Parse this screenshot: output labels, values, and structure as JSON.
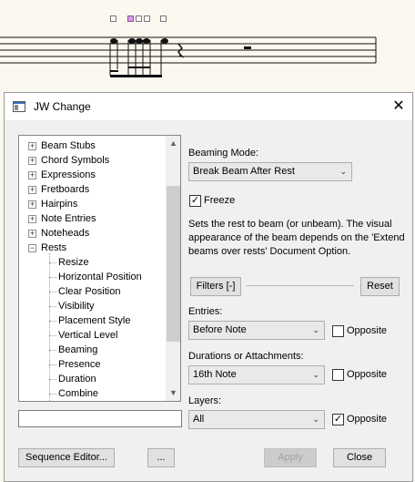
{
  "dialog": {
    "title": "JW Change",
    "close_glyph": "✕"
  },
  "tree": {
    "expand_glyph": "+",
    "collapse_glyph": "−",
    "items": [
      {
        "label": "Beam Stubs",
        "kind": "collapsed"
      },
      {
        "label": "Chord Symbols",
        "kind": "collapsed"
      },
      {
        "label": "Expressions",
        "kind": "collapsed"
      },
      {
        "label": "Fretboards",
        "kind": "collapsed"
      },
      {
        "label": "Hairpins",
        "kind": "collapsed"
      },
      {
        "label": "Note Entries",
        "kind": "collapsed"
      },
      {
        "label": "Noteheads",
        "kind": "collapsed"
      },
      {
        "label": "Rests",
        "kind": "expanded"
      },
      {
        "label": "Resize",
        "kind": "child"
      },
      {
        "label": "Horizontal Position",
        "kind": "child"
      },
      {
        "label": "Clear Position",
        "kind": "child"
      },
      {
        "label": "Visibility",
        "kind": "child"
      },
      {
        "label": "Placement Style",
        "kind": "child"
      },
      {
        "label": "Vertical Level",
        "kind": "child"
      },
      {
        "label": "Beaming",
        "kind": "child"
      },
      {
        "label": "Presence",
        "kind": "child"
      },
      {
        "label": "Duration",
        "kind": "child"
      },
      {
        "label": "Combine",
        "kind": "child"
      }
    ]
  },
  "filter_input": {
    "value": ""
  },
  "beaming": {
    "label": "Beaming Mode:",
    "value": "Break Beam After Rest",
    "freeze_label": "Freeze",
    "freeze_checked": true,
    "description": "Sets the rest to beam (or unbeam). The visual appearance of the beam depends on the 'Extend beams over rests' Document Option."
  },
  "filters": {
    "button": "Filters [-]",
    "reset": "Reset"
  },
  "entries": {
    "label": "Entries:",
    "value": "Before Note",
    "opposite_label": "Opposite",
    "opposite_checked": false
  },
  "durations": {
    "label": "Durations or Attachments:",
    "value": "16th Note",
    "opposite_label": "Opposite",
    "opposite_checked": false
  },
  "layers": {
    "label": "Layers:",
    "value": "All",
    "opposite_label": "Opposite",
    "opposite_checked": true
  },
  "footer": {
    "sequence_editor": "Sequence Editor...",
    "more": "...",
    "apply": "Apply",
    "close": "Close"
  },
  "glyphs": {
    "check": "✓",
    "dropdown": "⌄",
    "up": "▲",
    "down": "▼"
  }
}
